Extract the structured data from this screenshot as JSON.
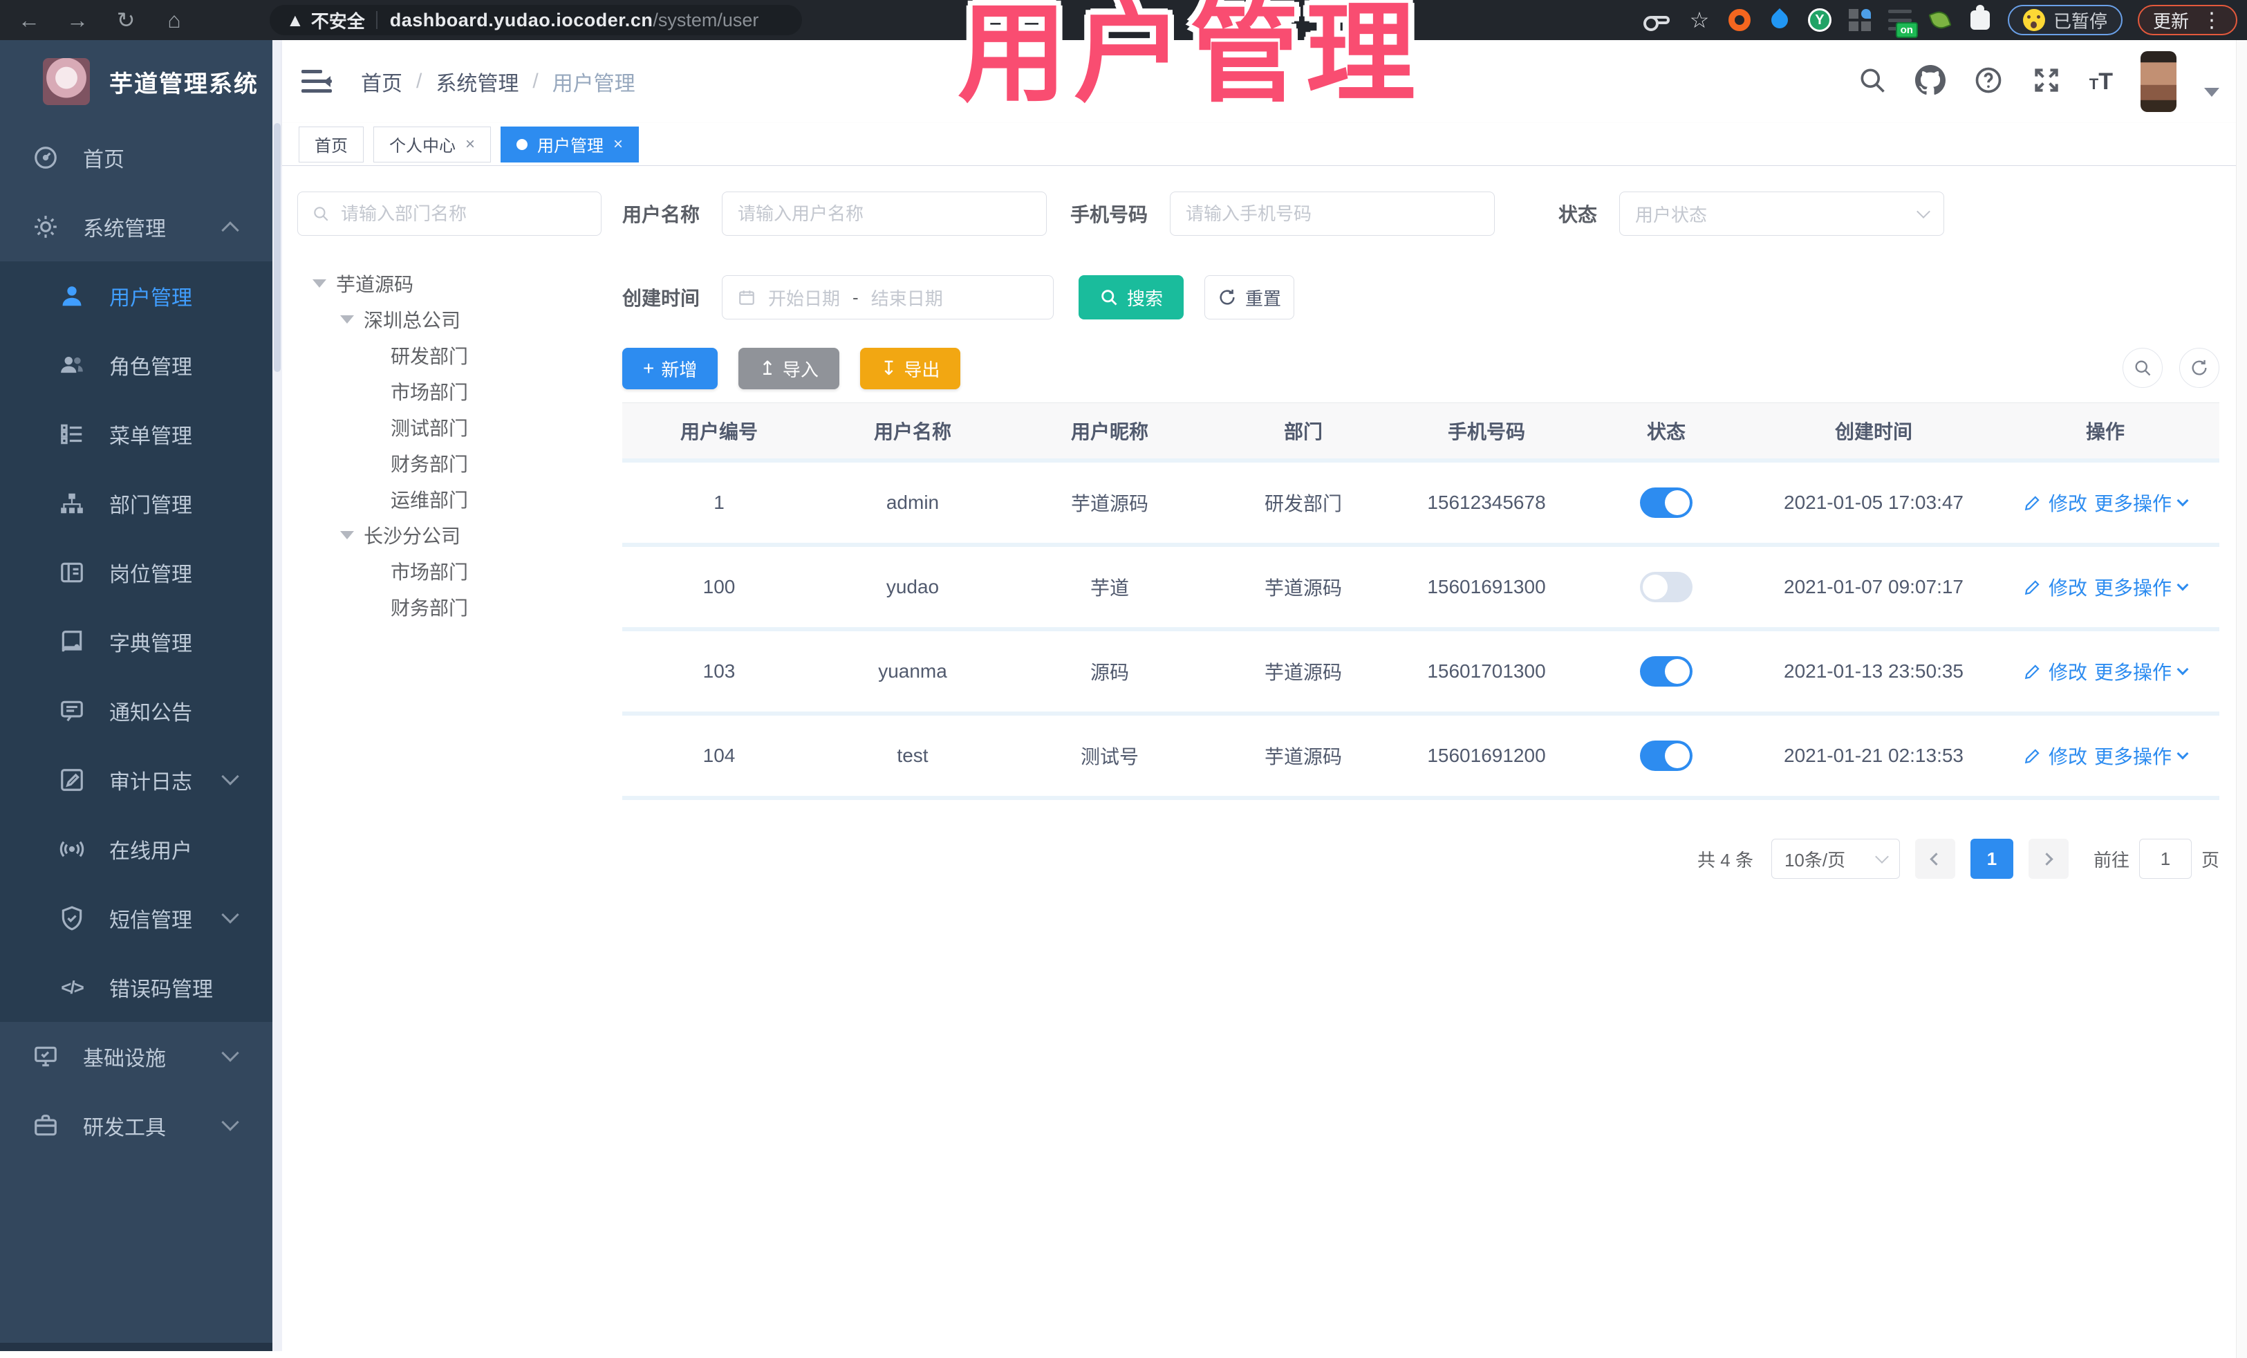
{
  "browser": {
    "security_label": "不安全",
    "url_host": "dashboard.yudao.iocoder.cn",
    "url_path": "/system/user",
    "paused_label": "已暂停",
    "update_label": "更新",
    "extension_y_letter": "Y",
    "on_badge": "on"
  },
  "overlay": {
    "title": "用户管理",
    "color": "#f94d71"
  },
  "sidebar": {
    "logo_title": "芋道管理系统",
    "items": [
      {
        "label": "首页",
        "icon": "dashboard-icon"
      },
      {
        "label": "系统管理",
        "icon": "gear-icon",
        "chevron": "up"
      },
      {
        "label": "用户管理",
        "icon": "user-icon",
        "active": true
      },
      {
        "label": "角色管理",
        "icon": "roles-icon"
      },
      {
        "label": "菜单管理",
        "icon": "menu-list-icon"
      },
      {
        "label": "部门管理",
        "icon": "sitemap-icon"
      },
      {
        "label": "岗位管理",
        "icon": "id-card-icon"
      },
      {
        "label": "字典管理",
        "icon": "book-icon"
      },
      {
        "label": "通知公告",
        "icon": "notice-icon"
      },
      {
        "label": "审计日志",
        "icon": "audit-icon",
        "chevron": "down"
      },
      {
        "label": "在线用户",
        "icon": "online-icon"
      },
      {
        "label": "短信管理",
        "icon": "sms-shield-icon",
        "chevron": "down"
      },
      {
        "label": "错误码管理",
        "icon": "code-icon",
        "code_glyph": "</>"
      },
      {
        "label": "基础设施",
        "icon": "infra-icon",
        "chevron": "down"
      },
      {
        "label": "研发工具",
        "icon": "tools-icon",
        "chevron": "down"
      }
    ]
  },
  "header": {
    "breadcrumb": [
      "首页",
      "系统管理",
      "用户管理"
    ],
    "separator": "/",
    "font_icon": "tT"
  },
  "tabs": [
    {
      "label": "首页"
    },
    {
      "label": "个人中心",
      "close": "×"
    },
    {
      "label": "用户管理",
      "close": "×",
      "active": true
    }
  ],
  "dept_panel": {
    "search_placeholder": "请输入部门名称",
    "tree": [
      {
        "label": "芋道源码"
      },
      {
        "label": "深圳总公司"
      },
      {
        "label": "研发部门"
      },
      {
        "label": "市场部门"
      },
      {
        "label": "测试部门"
      },
      {
        "label": "财务部门"
      },
      {
        "label": "运维部门"
      },
      {
        "label": "长沙分公司"
      },
      {
        "label": "市场部门"
      },
      {
        "label": "财务部门"
      }
    ]
  },
  "filters": {
    "username_label": "用户名称",
    "username_placeholder": "请输入用户名称",
    "mobile_label": "手机号码",
    "mobile_placeholder": "请输入手机号码",
    "status_label": "状态",
    "status_placeholder": "用户状态",
    "created_label": "创建时间",
    "date_start_placeholder": "开始日期",
    "date_separator": "-",
    "date_end_placeholder": "结束日期",
    "search_button": "搜索",
    "reset_button": "重置"
  },
  "toolbar": {
    "add_button": "新增",
    "add_glyph": "+",
    "import_button": "导入",
    "import_glyph": "↥",
    "export_button": "导出",
    "export_glyph": "↧"
  },
  "table": {
    "headers": [
      "用户编号",
      "用户名称",
      "用户昵称",
      "部门",
      "手机号码",
      "状态",
      "创建时间",
      "操作"
    ],
    "edit_action": "修改",
    "more_action": "更多操作",
    "rows": [
      {
        "id": "1",
        "username": "admin",
        "nickname": "芋道源码",
        "dept": "研发部门",
        "mobile": "15612345678",
        "status": "on",
        "created": "2021-01-05 17:03:47"
      },
      {
        "id": "100",
        "username": "yudao",
        "nickname": "芋道",
        "dept": "芋道源码",
        "mobile": "15601691300",
        "status": "off",
        "created": "2021-01-07 09:07:17"
      },
      {
        "id": "103",
        "username": "yuanma",
        "nickname": "源码",
        "dept": "芋道源码",
        "mobile": "15601701300",
        "status": "on",
        "created": "2021-01-13 23:50:35"
      },
      {
        "id": "104",
        "username": "test",
        "nickname": "测试号",
        "dept": "芋道源码",
        "mobile": "15601691200",
        "status": "on",
        "created": "2021-01-21 02:13:53"
      }
    ]
  },
  "pagination": {
    "total": "共 4 条",
    "page_size": "10条/页",
    "current_page": "1",
    "goto_label": "前往",
    "goto_value": "1",
    "page_unit": "页"
  },
  "colors": {
    "accent_blue": "#2d8cf0",
    "teal": "#1abc9c",
    "export_orange": "#f2a712",
    "sidebar_bg": "#33475d"
  }
}
